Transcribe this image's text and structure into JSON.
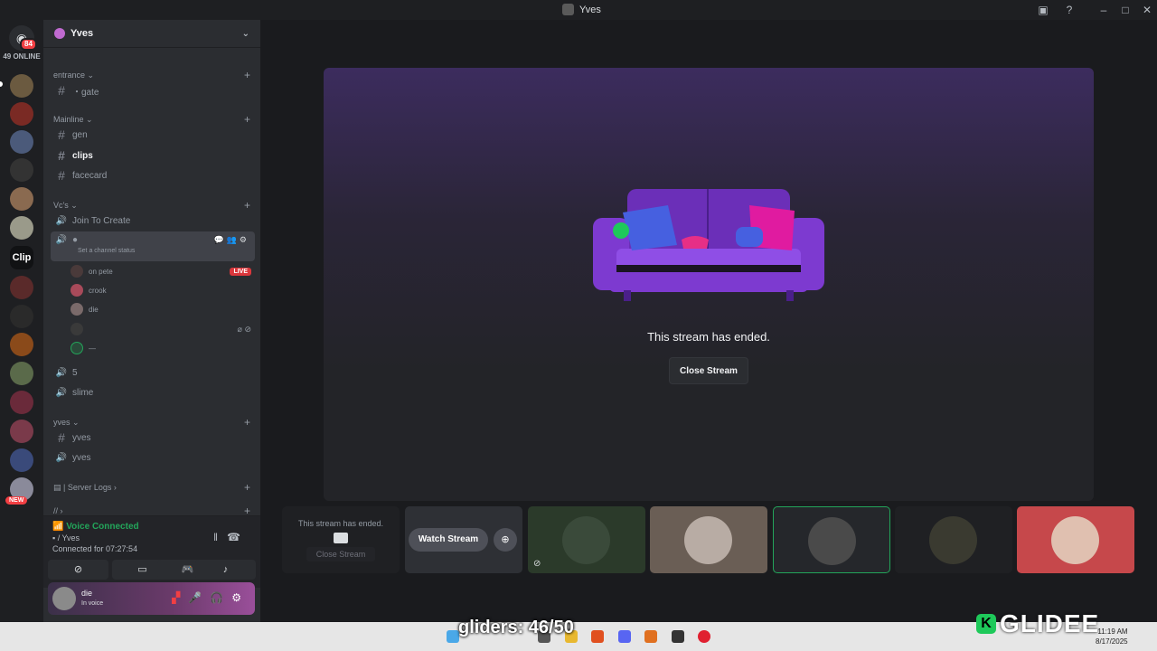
{
  "window": {
    "title": "Yves"
  },
  "rail": {
    "home_badge": "84",
    "online_count": "49 ONLINE",
    "clip_label": "Clip",
    "new_badge": "NEW"
  },
  "server": {
    "name": "Yves"
  },
  "categories": {
    "entrance": "entrance",
    "mainline": "Mainline",
    "vcs": "Vc's",
    "yves": "yves",
    "logs": "| Server Logs",
    "slash": "//"
  },
  "channels": {
    "gate": "・gate",
    "gen": "gen",
    "clips": "clips",
    "facecard": "facecard",
    "join": "Join To Create",
    "set_status": "Set a channel status",
    "five": "5",
    "slime": "slime",
    "yves_text": "yves",
    "yves_voice": "yves"
  },
  "members": [
    {
      "name": "on pete",
      "live": "LIVE"
    },
    {
      "name": "crook"
    },
    {
      "name": "die"
    },
    {
      "name": ""
    },
    {
      "name": "—"
    }
  ],
  "voice": {
    "status": "Voice Connected",
    "location": "/ Yves",
    "connected_for": "Connected for 07:27:54"
  },
  "user": {
    "name": "die",
    "state": "In voice"
  },
  "stage": {
    "message": "This stream has ended.",
    "close_label": "Close Stream"
  },
  "tiles": {
    "ended_message": "This stream has ended.",
    "ended_close": "Close Stream",
    "watch_label": "Watch Stream"
  },
  "overlay": {
    "gliders": "gliders: 46/50",
    "brand": "GLIDEE",
    "brand_k": "K"
  },
  "clock": {
    "time": "11:19 AM",
    "date": "8/17/2025"
  },
  "colors": {
    "accent_green": "#23a55a",
    "live_red": "#da373c",
    "badge_red": "#f23f43"
  }
}
